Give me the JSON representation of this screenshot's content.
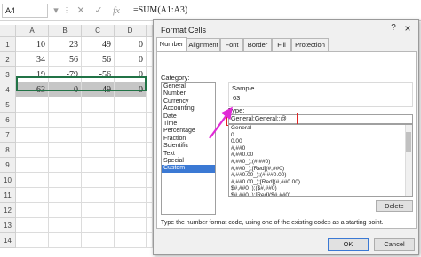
{
  "formula_bar": {
    "name_box": "A4",
    "formula": "=SUM(A1:A3)",
    "icons": [
      "dropdown-icon",
      "more-icon",
      "cancel-icon",
      "enter-icon",
      "function-icon"
    ]
  },
  "sheet": {
    "columns": [
      "A",
      "B",
      "C",
      "D"
    ],
    "rows": [
      {
        "header": "1",
        "cells": [
          "10",
          "23",
          "49",
          "0"
        ]
      },
      {
        "header": "2",
        "cells": [
          "34",
          "56",
          "56",
          "0"
        ]
      },
      {
        "header": "3",
        "cells": [
          "19",
          "-79",
          "-56",
          "0"
        ]
      },
      {
        "header": "4",
        "cells": [
          "63",
          "0",
          "49",
          "0"
        ]
      },
      {
        "header": "5",
        "cells": [
          "",
          "",
          "",
          ""
        ]
      },
      {
        "header": "6",
        "cells": [
          "",
          "",
          "",
          ""
        ]
      },
      {
        "header": "7",
        "cells": [
          "",
          "",
          "",
          ""
        ]
      },
      {
        "header": "8",
        "cells": [
          "",
          "",
          "",
          ""
        ]
      },
      {
        "header": "9",
        "cells": [
          "",
          "",
          "",
          ""
        ]
      },
      {
        "header": "10",
        "cells": [
          "",
          "",
          "",
          ""
        ]
      },
      {
        "header": "11",
        "cells": [
          "",
          "",
          "",
          ""
        ]
      },
      {
        "header": "12",
        "cells": [
          "",
          "",
          "",
          ""
        ]
      },
      {
        "header": "13",
        "cells": [
          "",
          "",
          "",
          ""
        ]
      },
      {
        "header": "14",
        "cells": [
          "",
          "",
          "",
          ""
        ]
      }
    ]
  },
  "dialog": {
    "title": "Format Cells",
    "help": "?",
    "close": "×",
    "tabs": [
      "Number",
      "Alignment",
      "Font",
      "Border",
      "Fill",
      "Protection"
    ],
    "category_label": "Category:",
    "categories": [
      "General",
      "Number",
      "Currency",
      "Accounting",
      "Date",
      "Time",
      "Percentage",
      "Fraction",
      "Scientific",
      "Text",
      "Special",
      "Custom"
    ],
    "selected_category": "Custom",
    "sample_label": "Sample",
    "sample_value": "63",
    "type_label": "Type:",
    "type_value": "General;General;;@",
    "formats": [
      "General",
      "0",
      "0.00",
      "#,##0",
      "#,##0.00",
      "#,##0_);(#,##0)",
      "#,##0_);[Red](#,##0)",
      "#,##0.00_);(#,##0.00)",
      "#,##0.00_);[Red](#,##0.00)",
      "$#,##0_);($#,##0)",
      "$#,##0_);[Red]($#,##0)",
      "$#,##0.00_);($#,##0.00)"
    ],
    "delete_label": "Delete",
    "hint": "Type the number format code, using one of the existing codes as a starting point.",
    "ok_label": "OK",
    "cancel_label": "Cancel"
  },
  "colors": {
    "selection_border": "#217346",
    "selected_cells": "#c6c6c6",
    "list_highlight": "#3b79d4",
    "annotation_box": "#e02424",
    "annotation_arrow": "#e02bd6"
  }
}
